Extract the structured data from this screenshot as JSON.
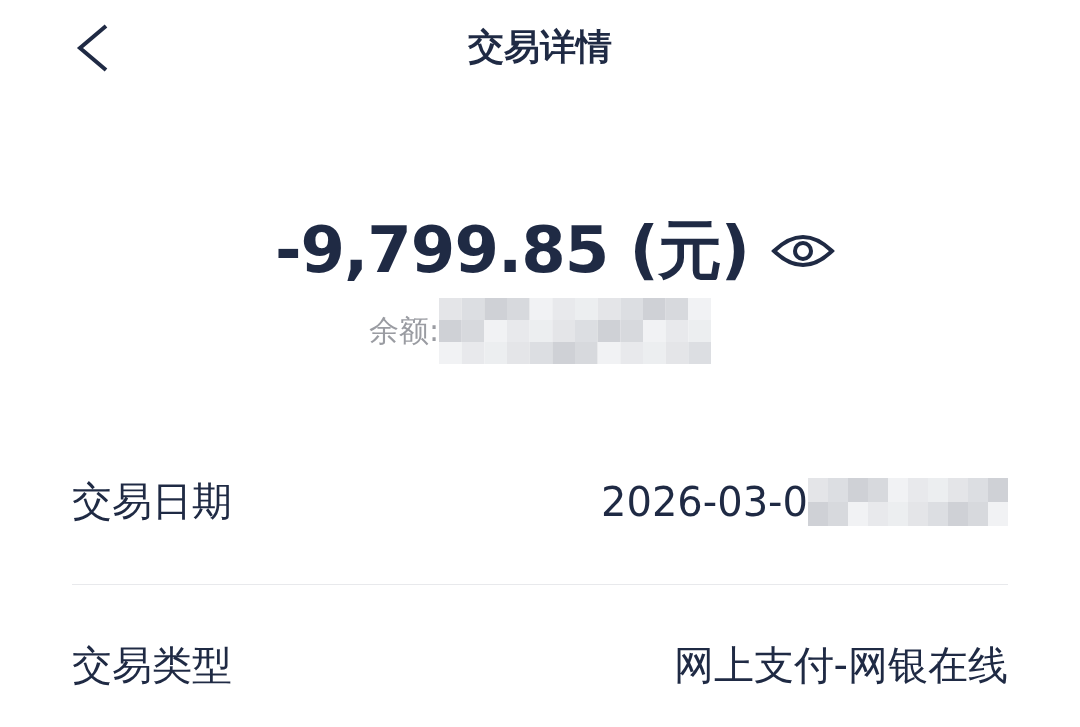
{
  "header": {
    "title": "交易详情"
  },
  "amount": {
    "value": "-9,799.85 (元)"
  },
  "balance": {
    "label": "余额:"
  },
  "rows": [
    {
      "label": "交易日期",
      "value": "2026-03-0",
      "masked": true
    },
    {
      "label": "交易类型",
      "value": "网上支付-网银在线",
      "masked": false
    }
  ]
}
